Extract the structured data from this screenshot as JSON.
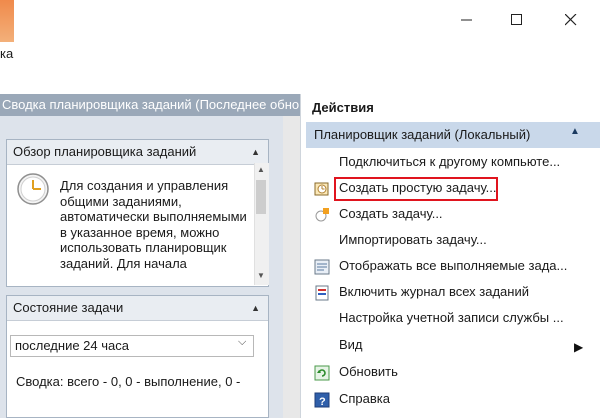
{
  "window": {
    "menu_item": "ка",
    "minimize_icon": "minimize-icon",
    "maximize_icon": "maximize-icon",
    "close_icon": "close-icon"
  },
  "left": {
    "summary_header": "Сводка планировщика заданий (Последнее обнов",
    "overview": {
      "title": "Обзор планировщика заданий",
      "text": "Для создания и управления общими заданиями, автоматически выполняемыми в указанное время, можно использовать планировщик заданий. Для начала"
    },
    "status": {
      "title": "Состояние задачи",
      "period_value": "последние 24 часа",
      "summary": "Сводка: всего - 0, 0 - выполнение, 0 -"
    }
  },
  "right": {
    "actions_header": "Действия",
    "scheduler_header": "Планировщик заданий (Локальный)",
    "actions": [
      {
        "label": "Подключиться к другому компьюте...",
        "icon": "none"
      },
      {
        "label": "Создать простую задачу...",
        "icon": "create-basic-task-icon"
      },
      {
        "label": "Создать задачу...",
        "icon": "create-task-icon"
      },
      {
        "label": "Импортировать задачу...",
        "icon": "none"
      },
      {
        "label": "Отображать все выполняемые зада...",
        "icon": "running-tasks-icon"
      },
      {
        "label": "Включить журнал всех заданий",
        "icon": "history-icon"
      },
      {
        "label": "Настройка учетной записи службы ...",
        "icon": "none"
      },
      {
        "label": "Вид",
        "icon": "none"
      },
      {
        "label": "Обновить",
        "icon": "refresh-icon"
      },
      {
        "label": "Справка",
        "icon": "help-icon"
      }
    ]
  },
  "colors": {
    "accent": "#c9d8ea",
    "highlight": "#e0141e",
    "left_header": "#9aa8b8"
  }
}
